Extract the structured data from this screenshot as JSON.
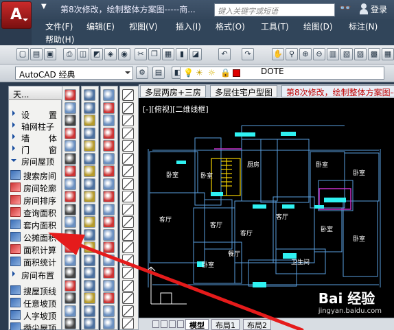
{
  "titlebar": {
    "logo": "A",
    "title": "第8次修改，绘制整体方案图-----商...",
    "search_placeholder": "键入关键字或短语",
    "login": "登录"
  },
  "menu": [
    "文件(F)",
    "编辑(E)",
    "视图(V)",
    "插入(I)",
    "格式(O)",
    "工具(T)",
    "绘图(D)",
    "标注(N)",
    "帮助(H)"
  ],
  "toolbar": {
    "workspace": "AutoCAD 经典",
    "layer": "DOTE"
  },
  "panel": {
    "title": "天...",
    "groups": [
      {
        "label_a": "设",
        "label_b": "置"
      },
      {
        "label_a": "轴网柱子",
        "label_b": ""
      },
      {
        "label_a": "墙",
        "label_b": "体"
      },
      {
        "label_a": "门",
        "label_b": "窗"
      },
      {
        "label_a": "房间屋顶",
        "label_b": ""
      }
    ],
    "items": [
      "搜索房间",
      "房间轮廓",
      "房间排序",
      "查询面积",
      "套内面积",
      "公摊面积",
      "面积计算",
      "面积统计",
      "房间布置",
      "搜屋顶线",
      "任意坡顶",
      "人字坡顶",
      "攒尖屋顶"
    ]
  },
  "doc_tabs": [
    "多层两房+三房",
    "多层住宅户型图",
    "第8次修改，绘制整体方案图---"
  ],
  "view_label": "[-][俯视][二维线框]",
  "bottom_tabs": [
    "模型",
    "布局1",
    "布局2"
  ],
  "rooms": [
    "卧室",
    "卧室",
    "客厅",
    "客厅",
    "餐厅",
    "厨房",
    "客厅",
    "卧室",
    "卧室",
    "卧室",
    "卧室",
    "客厅",
    "卧室",
    "卫生间"
  ],
  "watermark": {
    "logo": "Bai 经验",
    "url": "jingyan.baidu.com"
  },
  "colors": {
    "menubar": "#31455a",
    "canvas": "#000000",
    "accent_red": "#c00000",
    "arrow": "#e51b1b",
    "cad_blue": "#5aa0e0"
  }
}
